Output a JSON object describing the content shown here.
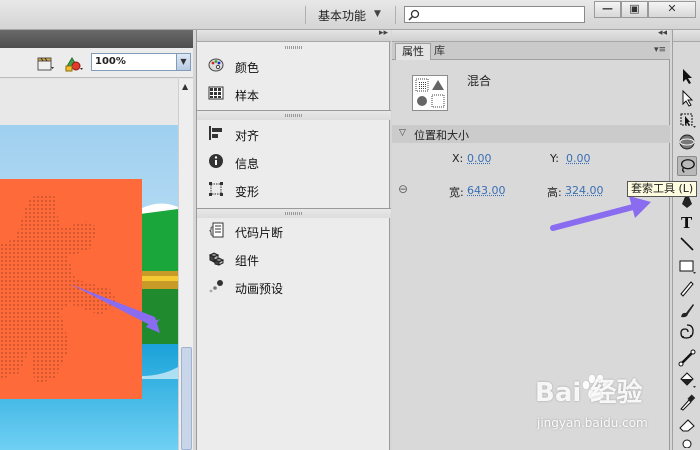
{
  "topbar": {
    "workspace_label": "基本功能",
    "workspace_arrow": "▼",
    "search_value": "",
    "window_buttons": [
      "—",
      "▣",
      "✕"
    ]
  },
  "stage": {
    "zoom_value": "100%",
    "panel_arrows": "◂◂",
    "character_text": "大"
  },
  "mid_panel": {
    "collapse_arrows": "▸▸",
    "items": [
      {
        "label": "颜色",
        "icon": "palette-icon"
      },
      {
        "label": "样本",
        "icon": "swatches-icon"
      },
      {
        "label": "对齐",
        "icon": "align-icon"
      },
      {
        "label": "信息",
        "icon": "info-icon"
      },
      {
        "label": "变形",
        "icon": "transform-icon"
      },
      {
        "label": "代码片断",
        "icon": "code-snippets-icon"
      },
      {
        "label": "组件",
        "icon": "components-icon"
      },
      {
        "label": "动画预设",
        "icon": "motion-presets-icon"
      }
    ]
  },
  "properties": {
    "tabs": [
      "属性",
      "库"
    ],
    "menu_glyph": "▾≡",
    "object_label": "混合",
    "section_title": "位置和大小",
    "x_label": "X:",
    "x_value": "0.00",
    "y_label": "Y:",
    "y_value": "0.00",
    "width_label": "宽:",
    "width_value": "643.00",
    "height_label": "高:",
    "height_value": "324.00",
    "link_glyph": "⊖"
  },
  "tools": {
    "header_arrows": "◂◂",
    "tooltip": "套索工具 (L)",
    "items": [
      "selection-tool",
      "subselection-tool",
      "free-transform-tool",
      "3d-rotation-tool",
      "lasso-tool",
      "pen-tool",
      "text-tool",
      "line-tool",
      "rectangle-tool",
      "pencil-tool",
      "brush-tool",
      "deco-tool",
      "bone-tool",
      "paint-bucket-tool",
      "eyedropper-tool",
      "eraser-tool"
    ]
  },
  "watermark": {
    "brand": "Bai 经验",
    "url": "jingyan.baidu.com"
  },
  "colors": {
    "accent": "#3b6fb5",
    "annotation_arrow": "#8a6cf0",
    "stage_shape": "#ff6a3a"
  }
}
